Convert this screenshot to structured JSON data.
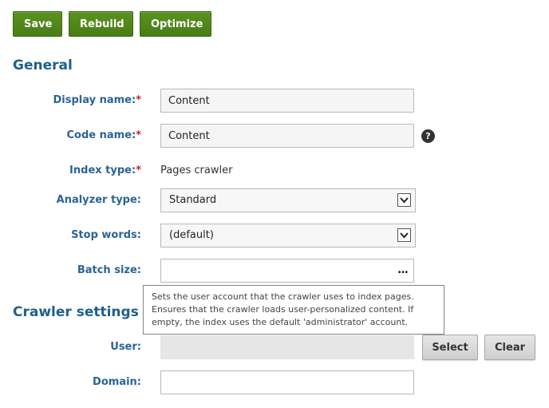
{
  "toolbar": {
    "save_label": "Save",
    "rebuild_label": "Rebuild",
    "optimize_label": "Optimize"
  },
  "sections": {
    "general": "General",
    "crawler": "Crawler settings"
  },
  "required_marker": "*",
  "fields": {
    "display_name": {
      "label": "Display name:",
      "value": "Content"
    },
    "code_name": {
      "label": "Code name:",
      "value": "Content"
    },
    "index_type": {
      "label": "Index type:",
      "value": "Pages crawler"
    },
    "analyzer_type": {
      "label": "Analyzer type:",
      "value": "Standard"
    },
    "stop_words": {
      "label": "Stop words:",
      "value": "(default)"
    },
    "batch_size": {
      "label": "Batch size:",
      "value": ""
    },
    "user": {
      "label": "User:",
      "value": ""
    },
    "domain": {
      "label": "Domain:",
      "value": ""
    }
  },
  "help_icon": {
    "glyph": "?"
  },
  "ellipsis": "...",
  "tooltip": {
    "text": "Sets the user account that the crawler uses to index pages. Ensures that the crawler loads user-personalized content. If empty, the index uses the default 'administrator' account."
  },
  "user_buttons": {
    "select_label": "Select",
    "clear_label": "Clear"
  },
  "colors": {
    "primary_green": "#5b9220",
    "heading_blue": "#1f5f8b",
    "label_blue": "#2a6496",
    "required_red": "#cc2222"
  }
}
